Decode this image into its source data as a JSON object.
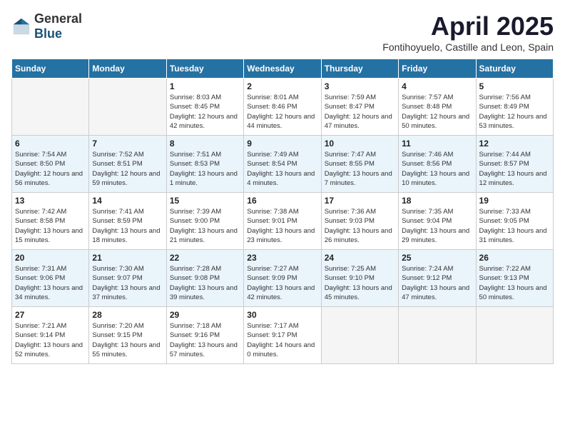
{
  "header": {
    "logo": {
      "general": "General",
      "blue": "Blue"
    },
    "title": "April 2025",
    "subtitle": "Fontihoyuelo, Castille and Leon, Spain"
  },
  "days_of_week": [
    "Sunday",
    "Monday",
    "Tuesday",
    "Wednesday",
    "Thursday",
    "Friday",
    "Saturday"
  ],
  "weeks": [
    [
      {
        "day": "",
        "content": ""
      },
      {
        "day": "",
        "content": ""
      },
      {
        "day": "1",
        "content": "Sunrise: 8:03 AM\nSunset: 8:45 PM\nDaylight: 12 hours and 42 minutes."
      },
      {
        "day": "2",
        "content": "Sunrise: 8:01 AM\nSunset: 8:46 PM\nDaylight: 12 hours and 44 minutes."
      },
      {
        "day": "3",
        "content": "Sunrise: 7:59 AM\nSunset: 8:47 PM\nDaylight: 12 hours and 47 minutes."
      },
      {
        "day": "4",
        "content": "Sunrise: 7:57 AM\nSunset: 8:48 PM\nDaylight: 12 hours and 50 minutes."
      },
      {
        "day": "5",
        "content": "Sunrise: 7:56 AM\nSunset: 8:49 PM\nDaylight: 12 hours and 53 minutes."
      }
    ],
    [
      {
        "day": "6",
        "content": "Sunrise: 7:54 AM\nSunset: 8:50 PM\nDaylight: 12 hours and 56 minutes."
      },
      {
        "day": "7",
        "content": "Sunrise: 7:52 AM\nSunset: 8:51 PM\nDaylight: 12 hours and 59 minutes."
      },
      {
        "day": "8",
        "content": "Sunrise: 7:51 AM\nSunset: 8:53 PM\nDaylight: 13 hours and 1 minute."
      },
      {
        "day": "9",
        "content": "Sunrise: 7:49 AM\nSunset: 8:54 PM\nDaylight: 13 hours and 4 minutes."
      },
      {
        "day": "10",
        "content": "Sunrise: 7:47 AM\nSunset: 8:55 PM\nDaylight: 13 hours and 7 minutes."
      },
      {
        "day": "11",
        "content": "Sunrise: 7:46 AM\nSunset: 8:56 PM\nDaylight: 13 hours and 10 minutes."
      },
      {
        "day": "12",
        "content": "Sunrise: 7:44 AM\nSunset: 8:57 PM\nDaylight: 13 hours and 12 minutes."
      }
    ],
    [
      {
        "day": "13",
        "content": "Sunrise: 7:42 AM\nSunset: 8:58 PM\nDaylight: 13 hours and 15 minutes."
      },
      {
        "day": "14",
        "content": "Sunrise: 7:41 AM\nSunset: 8:59 PM\nDaylight: 13 hours and 18 minutes."
      },
      {
        "day": "15",
        "content": "Sunrise: 7:39 AM\nSunset: 9:00 PM\nDaylight: 13 hours and 21 minutes."
      },
      {
        "day": "16",
        "content": "Sunrise: 7:38 AM\nSunset: 9:01 PM\nDaylight: 13 hours and 23 minutes."
      },
      {
        "day": "17",
        "content": "Sunrise: 7:36 AM\nSunset: 9:03 PM\nDaylight: 13 hours and 26 minutes."
      },
      {
        "day": "18",
        "content": "Sunrise: 7:35 AM\nSunset: 9:04 PM\nDaylight: 13 hours and 29 minutes."
      },
      {
        "day": "19",
        "content": "Sunrise: 7:33 AM\nSunset: 9:05 PM\nDaylight: 13 hours and 31 minutes."
      }
    ],
    [
      {
        "day": "20",
        "content": "Sunrise: 7:31 AM\nSunset: 9:06 PM\nDaylight: 13 hours and 34 minutes."
      },
      {
        "day": "21",
        "content": "Sunrise: 7:30 AM\nSunset: 9:07 PM\nDaylight: 13 hours and 37 minutes."
      },
      {
        "day": "22",
        "content": "Sunrise: 7:28 AM\nSunset: 9:08 PM\nDaylight: 13 hours and 39 minutes."
      },
      {
        "day": "23",
        "content": "Sunrise: 7:27 AM\nSunset: 9:09 PM\nDaylight: 13 hours and 42 minutes."
      },
      {
        "day": "24",
        "content": "Sunrise: 7:25 AM\nSunset: 9:10 PM\nDaylight: 13 hours and 45 minutes."
      },
      {
        "day": "25",
        "content": "Sunrise: 7:24 AM\nSunset: 9:12 PM\nDaylight: 13 hours and 47 minutes."
      },
      {
        "day": "26",
        "content": "Sunrise: 7:22 AM\nSunset: 9:13 PM\nDaylight: 13 hours and 50 minutes."
      }
    ],
    [
      {
        "day": "27",
        "content": "Sunrise: 7:21 AM\nSunset: 9:14 PM\nDaylight: 13 hours and 52 minutes."
      },
      {
        "day": "28",
        "content": "Sunrise: 7:20 AM\nSunset: 9:15 PM\nDaylight: 13 hours and 55 minutes."
      },
      {
        "day": "29",
        "content": "Sunrise: 7:18 AM\nSunset: 9:16 PM\nDaylight: 13 hours and 57 minutes."
      },
      {
        "day": "30",
        "content": "Sunrise: 7:17 AM\nSunset: 9:17 PM\nDaylight: 14 hours and 0 minutes."
      },
      {
        "day": "",
        "content": ""
      },
      {
        "day": "",
        "content": ""
      },
      {
        "day": "",
        "content": ""
      }
    ]
  ]
}
